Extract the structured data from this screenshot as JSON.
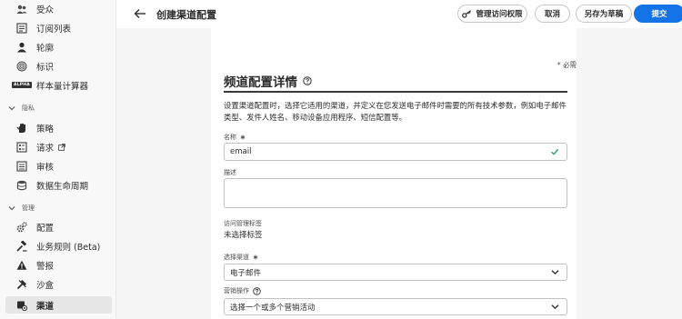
{
  "sidebar": {
    "items_top": [
      {
        "label": "受众",
        "icon": "audience-icon"
      },
      {
        "label": "订阅列表",
        "icon": "subscription-list-icon"
      },
      {
        "label": "轮廓",
        "icon": "profile-icon"
      },
      {
        "label": "标识",
        "icon": "identity-icon"
      },
      {
        "label": "样本量计算器",
        "icon": "alpha-badge",
        "badge": "ALPHA"
      }
    ],
    "section_privacy": "隐私",
    "items_privacy": [
      {
        "label": "策略",
        "icon": "policy-hand-icon"
      },
      {
        "label": "请求",
        "icon": "request-icon"
      },
      {
        "label": "审核",
        "icon": "audit-icon"
      },
      {
        "label": "数据生命周期",
        "icon": "data-lifecycle-icon"
      }
    ],
    "section_admin": "管理",
    "items_admin": [
      {
        "label": "配置",
        "icon": "configuration-icon"
      },
      {
        "label": "业务规则 (Beta)",
        "icon": "business-rules-icon"
      },
      {
        "label": "警报",
        "icon": "alert-icon"
      },
      {
        "label": "沙盒",
        "icon": "sandbox-icon"
      },
      {
        "label": "渠道",
        "icon": "channel-icon",
        "active": true
      }
    ]
  },
  "header": {
    "title": "创建渠道配置",
    "buttons": {
      "permissions": "管理访问权限",
      "cancel": "取消",
      "save_draft": "另存为草稿",
      "submit": "提交"
    }
  },
  "form": {
    "required_note": "* 必需",
    "title": "频道配置详情",
    "description": "设置渠道配置时，选择它适用的渠道，并定义在您发送电子邮件时需要的所有技术参数，例如电子邮件类型、发件人姓名、移动设备应用程序、短信配置等。",
    "name_label": "名称",
    "name_value": "email",
    "desc_label": "描述",
    "desc_value": "",
    "access_label": "访问管理标签",
    "access_value": "未选择标签",
    "channel_label": "选择渠道",
    "channel_value": "电子邮件",
    "marketing_label": "营销操作",
    "marketing_placeholder": "选择一个或多个营销活动"
  },
  "colors": {
    "accent": "#1473e6",
    "valid": "#2d9d78",
    "sidebar_bg": "#f8f8f8",
    "main_bg": "#f5f5f5"
  }
}
